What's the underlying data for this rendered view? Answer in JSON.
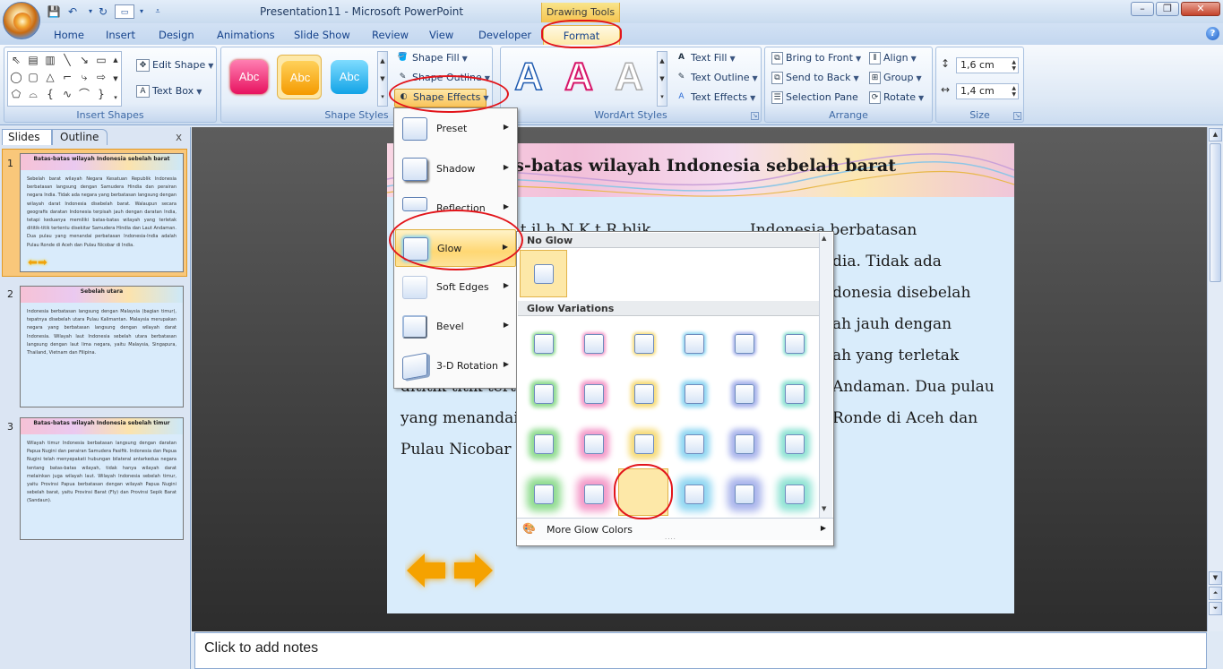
{
  "window": {
    "title": "Presentation11 - Microsoft PowerPoint",
    "context_tab_group": "Drawing Tools",
    "minimize_label": "–",
    "maximize_label": "❐",
    "close_label": "✕"
  },
  "tabs": [
    "Home",
    "Insert",
    "Design",
    "Animations",
    "Slide Show",
    "Review",
    "View",
    "Developer",
    "Format"
  ],
  "active_tab": "Format",
  "ribbon": {
    "insert_shapes": {
      "label": "Insert Shapes",
      "edit_shape": "Edit Shape",
      "text_box": "Text Box"
    },
    "shape_styles": {
      "label": "Shape Styles",
      "swatch_text": "Abc",
      "shape_fill": "Shape Fill",
      "shape_outline": "Shape Outline",
      "shape_effects": "Shape Effects"
    },
    "wordart_styles": {
      "label": "WordArt Styles",
      "text_fill": "Text Fill",
      "text_outline": "Text Outline",
      "text_effects": "Text Effects"
    },
    "arrange": {
      "label": "Arrange",
      "bring_to_front": "Bring to Front",
      "send_to_back": "Send to Back",
      "selection_pane": "Selection Pane",
      "align": "Align",
      "group": "Group",
      "rotate": "Rotate"
    },
    "size": {
      "label": "Size",
      "height": "1,6 cm",
      "width": "1,4 cm"
    }
  },
  "left_pane": {
    "tab_slides": "Slides",
    "tab_outline": "Outline",
    "close": "x",
    "thumbnails": [
      {
        "number": "1",
        "title": "Batas-batas wilayah Indonesia sebelah barat",
        "body": "Sebelah barat wilayah Negara Kesatuan Republik Indonesia berbatasan langsung dengan Samudera Hindia dan perairan negara India. Tidak ada negara yang berbatasan langsung dengan wilayah darat Indonesia disebelah barat. Walaupun secara geografis daratan Indonesia terpisah jauh dengan daratan India, tetapi keduanya memiliki batas-batas wilayah yang terletak dititik-titik tertentu disekitar Samudera Hindia dan Laut Andaman. Dua pulau yang menandai perbatasan Indonesia-India adalah Pulau Ronde di Aceh dan Pulau Nicobar di India."
      },
      {
        "number": "2",
        "title": "Sebelah utara",
        "body": "Indonesia berbatasan langsung dengan Malaysia (bagian timur), tepatnya disebelah utara Pulau Kalimantan. Malaysia merupakan negara yang berbatasan langsung dengan wilayah darat Indonesia. Wilayah laut Indonesia sebelah utara berbatasan langsung dengan laut lima negara, yaitu Malaysia, Singapura, Thailand, Vietnam dan Filipina."
      },
      {
        "number": "3",
        "title": "Batas-batas wilayah Indonesia sebelah timur",
        "body": "Wilayah timur Indonesia berbatasan langsung dengan daratan Papua Nugini dan perairan Samudera Pasifik. Indonesia dan Papua Nugini telah menyepakati hubungan bilateral antarkedua negara tentang batas-batas wilayah, tidak hanya wilayah darat melainkan juga wilayah laut. Wilayah Indonesia sebelah timur, yaitu Provinsi Papua berbatasan dengan wilayah Papua Nugini sebelah barat, yaitu Provinsi Barat (Fly) dan Provinsi Sepik Barat (Sandaun)."
      }
    ]
  },
  "slide": {
    "title": "as-batas wilayah Indonesia sebelah barat",
    "lines": [
      {
        "left": "",
        "right": "Indonesia berbatasan"
      },
      {
        "left": "",
        "right": "dia. Tidak ada"
      },
      {
        "left": "",
        "right": "donesia disebelah"
      },
      {
        "left": "",
        "right": "ah jauh dengan"
      },
      {
        "left": "",
        "right": "ah yang terletak"
      },
      {
        "left": "dititik-titik tert",
        "right": "Andaman. Dua pulau"
      },
      {
        "left": "yang menandai",
        "right": "Ronde di Aceh dan"
      },
      {
        "left": "Pulau Nicobar d",
        "right": ""
      }
    ],
    "line1_mid": "k    t    il  h  N      K      t      R    blik",
    "notes_placeholder": "Click to add notes"
  },
  "shape_effects_menu": {
    "items": [
      "Preset",
      "Shadow",
      "Reflection",
      "Glow",
      "Soft Edges",
      "Bevel",
      "3-D Rotation"
    ],
    "highlighted": "Glow"
  },
  "glow_gallery": {
    "no_glow_header": "No Glow",
    "variations_header": "Glow Variations",
    "colors": [
      "#8fdc8f",
      "#f49ac9",
      "#f7dc7a",
      "#8fd6f2",
      "#a9b4ec",
      "#8fe3d4"
    ],
    "rows": 4,
    "selected": {
      "row": 4,
      "col": 3
    },
    "more_colors": "More Glow Colors"
  }
}
